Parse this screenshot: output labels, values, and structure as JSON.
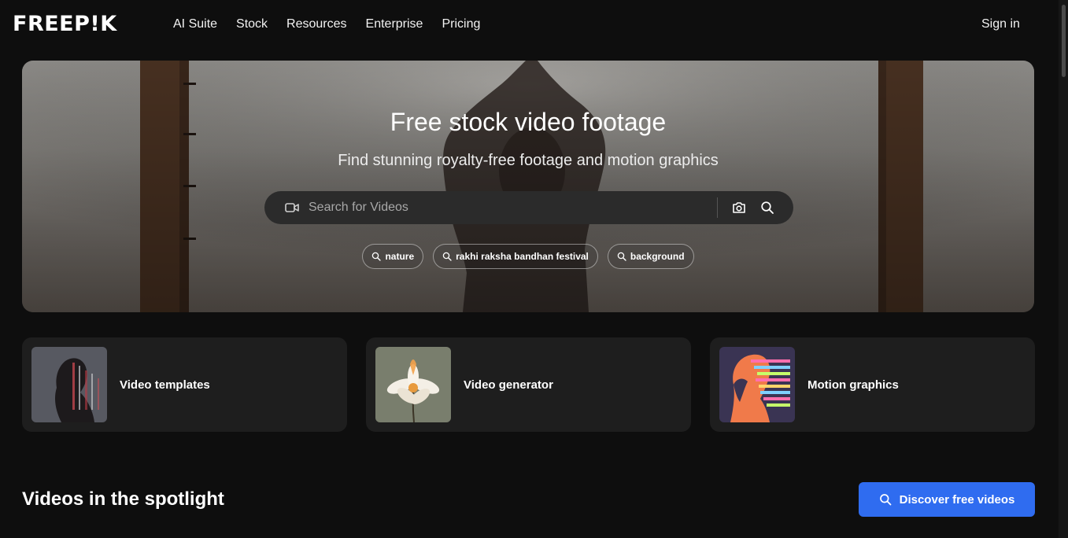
{
  "header": {
    "logo": "FREEP!K",
    "nav": [
      "AI Suite",
      "Stock",
      "Resources",
      "Enterprise",
      "Pricing"
    ],
    "sign_in": "Sign in"
  },
  "hero": {
    "title": "Free stock video footage",
    "subtitle": "Find stunning royalty-free footage and motion graphics",
    "search": {
      "placeholder": "Search for Videos",
      "value": "",
      "leading_icon": "video-camera-icon",
      "actions": [
        "camera-icon",
        "search-icon"
      ]
    },
    "suggestions": [
      "nature",
      "rakhi raksha bandhan festival",
      "background"
    ]
  },
  "categories": [
    {
      "label": "Video templates",
      "thumb": "woman-profile-glitch-thumbnail"
    },
    {
      "label": "Video generator",
      "thumb": "white-lily-flower-thumbnail"
    },
    {
      "label": "Motion graphics",
      "thumb": "rainbow-face-silhouette-thumbnail"
    }
  ],
  "spotlight": {
    "title": "Videos in the spotlight",
    "cta": "Discover free videos"
  },
  "colors": {
    "background": "#0e0e0e",
    "card": "#1e1e1e",
    "search_bar": "#2b2b2b",
    "accent": "#2f6cf0"
  }
}
